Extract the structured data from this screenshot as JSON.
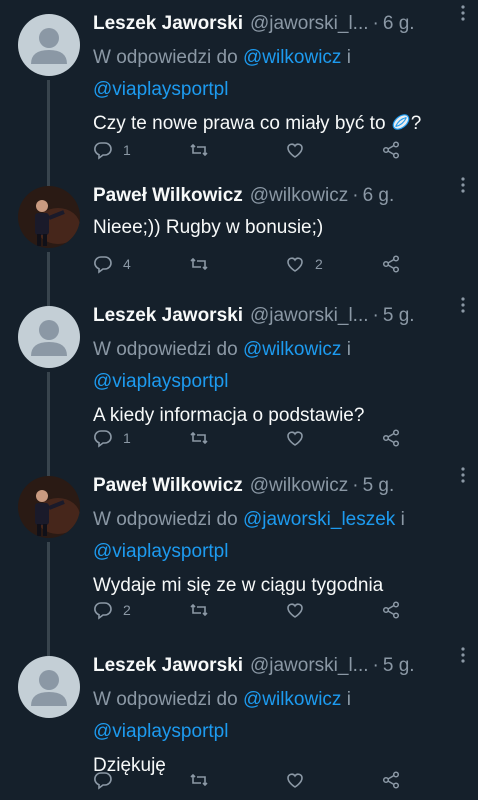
{
  "tweets": [
    {
      "name": "Leszek Jaworski",
      "handle": "@jaworski_l...",
      "time": "6 g.",
      "reply_prefix": "W odpowiedzi do ",
      "reply_mention1": "@wilkowicz",
      "reply_and": " i",
      "reply_mention2": "@viaplaysportpl",
      "text": "Czy te nowe prawa co miały być to",
      "text_suffix": "?",
      "emoji": "rugby-ball-icon",
      "replies": "1",
      "retweets": "",
      "likes": ""
    },
    {
      "name": "Paweł Wilkowicz",
      "handle": "@wilkowicz",
      "time": "6 g.",
      "text": "Nieee;)) Rugby w bonusie;)",
      "replies": "4",
      "retweets": "",
      "likes": "2"
    },
    {
      "name": "Leszek Jaworski",
      "handle": "@jaworski_l...",
      "time": "5 g.",
      "reply_prefix": "W odpowiedzi do ",
      "reply_mention1": "@wilkowicz",
      "reply_and": " i",
      "reply_mention2": "@viaplaysportpl",
      "text": "A kiedy informacja o podstawie?",
      "replies": "1",
      "retweets": "",
      "likes": ""
    },
    {
      "name": "Paweł Wilkowicz",
      "handle": "@wilkowicz",
      "time": "5 g.",
      "reply_prefix": "W odpowiedzi do ",
      "reply_mention1": "@jaworski_leszek",
      "reply_and": " i",
      "reply_mention2": "@viaplaysportpl",
      "text": "Wydaje mi się ze w ciągu tygodnia",
      "replies": "2",
      "retweets": "",
      "likes": ""
    },
    {
      "name": "Leszek Jaworski",
      "handle": "@jaworski_l...",
      "time": "5 g.",
      "reply_prefix": "W odpowiedzi do ",
      "reply_mention1": "@wilkowicz",
      "reply_and": " i",
      "reply_mention2": "@viaplaysportpl",
      "text": "Dziękuję",
      "replies": "",
      "retweets": "",
      "likes": ""
    }
  ],
  "colors": {
    "background": "#15202b",
    "text": "#f7f9f9",
    "secondary": "#8b98a5",
    "accent": "#1d9bf0",
    "thread_line": "#38444d"
  }
}
